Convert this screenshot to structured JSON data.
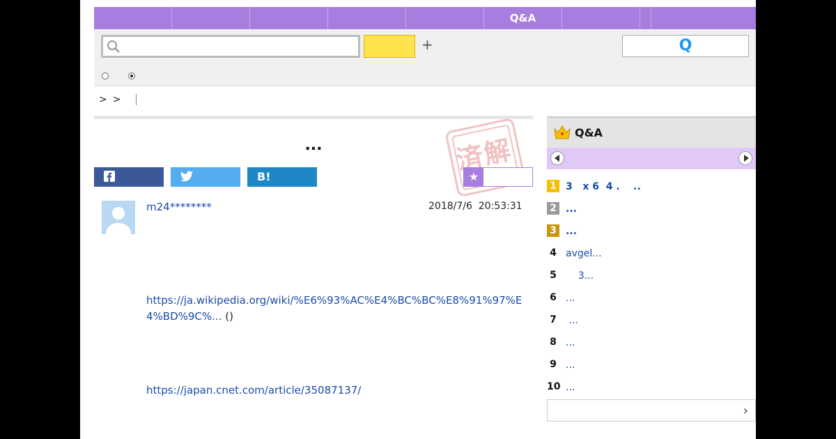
{
  "nav": {
    "tabs": [
      "",
      "",
      "",
      "",
      "",
      "Q&A",
      "",
      "",
      ""
    ]
  },
  "search": {
    "input_value": "",
    "button_label": "",
    "plus_label": "+",
    "ask_button_label": "Q"
  },
  "breadcrumb": [
    "&gt;",
    "&gt;"
  ],
  "question": {
    "title": "...",
    "stamp_text": "済解",
    "share": {
      "facebook": "f",
      "twitter": "t",
      "hatena": "B!"
    },
    "favorite_star": "★",
    "username": "m24********",
    "timestamp": "2018/7/6  20:53:31",
    "link1": "https://ja.wikipedia.org/wiki/%E6%93%AC%E4%BC%BC%E8%91%97%E4%BD%9C%...",
    "link1_suffix": " ()",
    "link2": "https://japan.cnet.com/article/35087137/"
  },
  "sidebar": {
    "title": "Q&A",
    "ranking": [
      {
        "rank": "1",
        "text": "3   x 6  4 .    ..",
        "medal": "#f5c000",
        "bold": true
      },
      {
        "rank": "2",
        "text": "...",
        "medal": "#999999",
        "bold": true
      },
      {
        "rank": "3",
        "text": "...",
        "medal": "#c9950c",
        "bold": true
      },
      {
        "rank": "4",
        "text": "avgel...",
        "medal": "",
        "bold": false
      },
      {
        "rank": "5",
        "text": "    3...",
        "medal": "",
        "bold": false
      },
      {
        "rank": "6",
        "text": "...",
        "medal": "",
        "bold": false
      },
      {
        "rank": "7",
        "text": " ...",
        "medal": "",
        "bold": false
      },
      {
        "rank": "8",
        "text": "...",
        "medal": "",
        "bold": false
      },
      {
        "rank": "9",
        "text": "...",
        "medal": "",
        "bold": false
      },
      {
        "rank": "10",
        "text": "...",
        "medal": "",
        "bold": false
      }
    ],
    "more_chevron": "›"
  },
  "colors": {
    "accent": "#a77de0",
    "search_button": "#ffe34d",
    "link": "#1a4aa8",
    "facebook": "#3b5998",
    "twitter": "#55acee",
    "hatena": "#1e88c7"
  }
}
